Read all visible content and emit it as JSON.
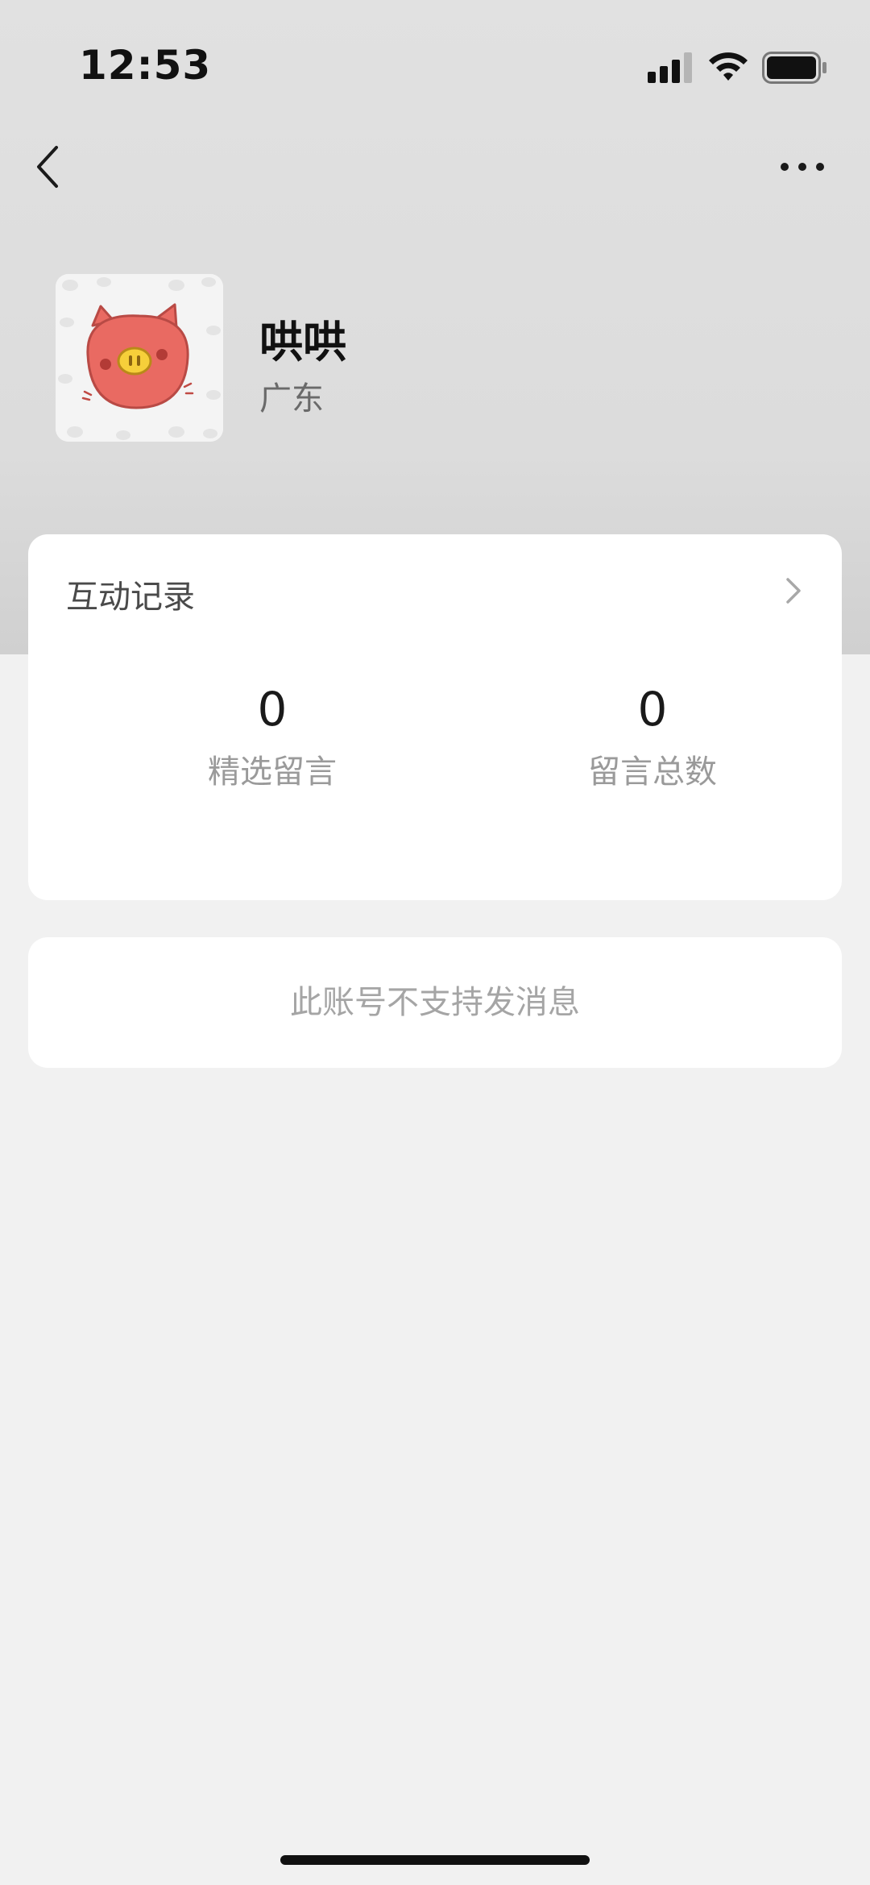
{
  "status_bar": {
    "time": "12:53"
  },
  "nav": {
    "back_icon": "chevron-left-icon",
    "more_icon": "ellipsis-icon"
  },
  "profile": {
    "name": "哄哄",
    "region": "广东",
    "avatar_icon": "pig-avatar"
  },
  "interaction": {
    "title": "互动记录",
    "stats": [
      {
        "value": "0",
        "label": "精选留言"
      },
      {
        "value": "0",
        "label": "留言总数"
      }
    ]
  },
  "message_notice": "此账号不支持发消息",
  "colors": {
    "header_bg": "#dcdcdc",
    "page_bg": "#f1f1f1",
    "card_bg": "#ffffff",
    "avatar_pig": "#e96a62",
    "pig_nose": "#f6cf3a"
  }
}
